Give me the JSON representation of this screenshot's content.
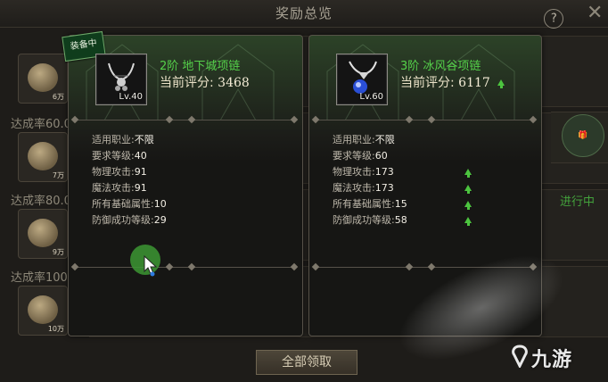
{
  "window": {
    "title": "奖励总览",
    "help_icon": "question-icon",
    "help_label": "?",
    "close_icon": "close-icon"
  },
  "background": {
    "rows": [
      {
        "label": "",
        "count": "6万"
      },
      {
        "label": "达成率60.0",
        "count": "7万"
      },
      {
        "label": "达成率80.0",
        "count": "9万"
      },
      {
        "label": "达成率100",
        "count": "10万"
      }
    ],
    "status_text": "进行中",
    "claim_all_label": "全部领取"
  },
  "cards": [
    {
      "tag": "装备中",
      "item_level": "Lv.40",
      "item_name": "2阶 地下城项链",
      "score_label": "当前评分:",
      "score_value": "3468",
      "score_up": false,
      "name_color": "#55d14a",
      "stats": [
        {
          "label": "适用职业:",
          "value": "不限",
          "up": false
        },
        {
          "label": "要求等级:",
          "value": "40",
          "up": false
        },
        {
          "label": "物理攻击:",
          "value": "91",
          "up": false
        },
        {
          "label": "魔法攻击:",
          "value": "91",
          "up": false
        },
        {
          "label": "所有基础属性:",
          "value": "10",
          "up": false
        },
        {
          "label": "防御成功等级:",
          "value": "29",
          "up": false
        }
      ]
    },
    {
      "tag": "",
      "item_level": "Lv.60",
      "item_name": "3阶 冰风谷项链",
      "score_label": "当前评分:",
      "score_value": "6117",
      "score_up": true,
      "name_color": "#55d14a",
      "stats": [
        {
          "label": "适用职业:",
          "value": "不限",
          "up": false
        },
        {
          "label": "要求等级:",
          "value": "60",
          "up": false
        },
        {
          "label": "物理攻击:",
          "value": "173",
          "up": true
        },
        {
          "label": "魔法攻击:",
          "value": "173",
          "up": true
        },
        {
          "label": "所有基础属性:",
          "value": "15",
          "up": true
        },
        {
          "label": "防御成功等级:",
          "value": "58",
          "up": true
        }
      ]
    }
  ],
  "watermark": "九游",
  "colors": {
    "accent_green": "#55d14a",
    "up_arrow": "#4cc43f",
    "progress_green": "#43a23c"
  }
}
